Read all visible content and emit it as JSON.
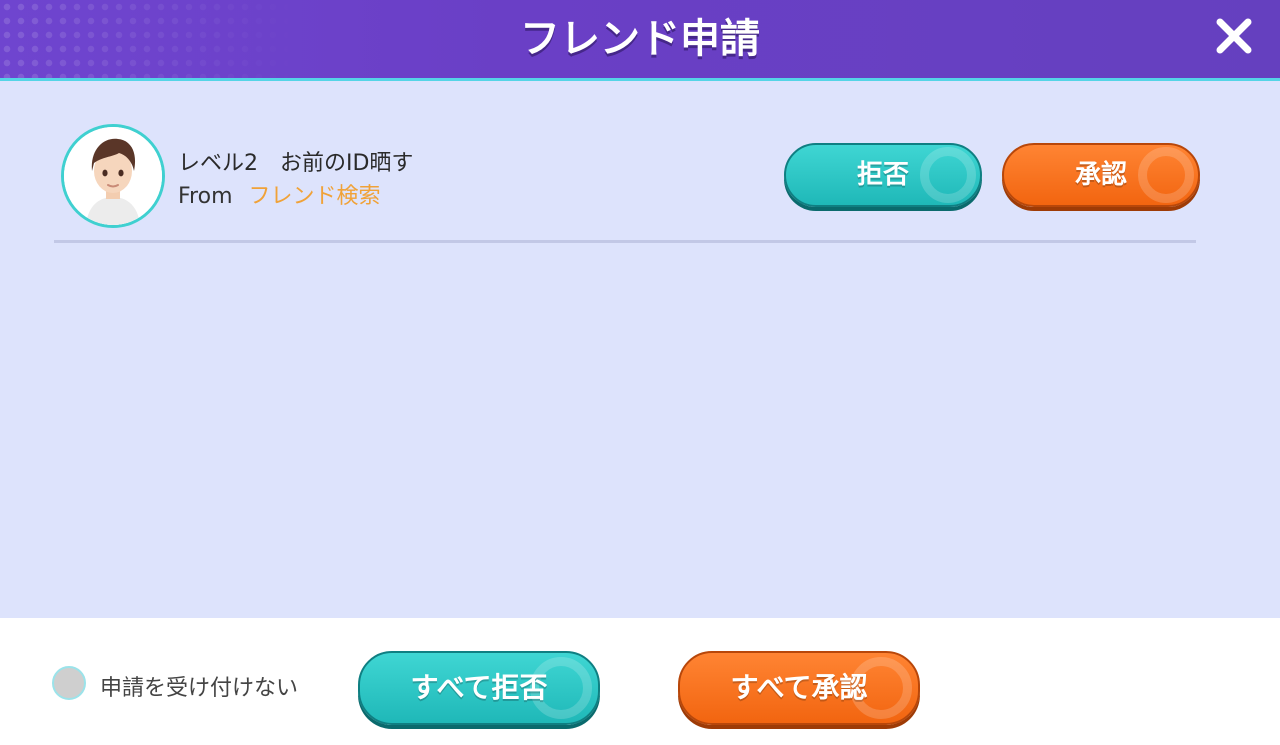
{
  "header": {
    "title": "フレンド申請"
  },
  "request": {
    "level_name": "レベル2　お前のID晒す",
    "from_label": "From",
    "source": "フレンド検索",
    "reject_label": "拒否",
    "accept_label": "承認"
  },
  "footer": {
    "no_accept_label": "申請を受け付けない",
    "reject_all_label": "すべて拒否",
    "accept_all_label": "すべて承認"
  },
  "colors": {
    "header": "#6a3fc6",
    "panel": "#dde3fc",
    "teal": "#22bcbc",
    "orange": "#f56d18",
    "source_text": "#f0a238"
  },
  "icons": [
    "close-icon",
    "avatar",
    "pokeball-icon"
  ]
}
